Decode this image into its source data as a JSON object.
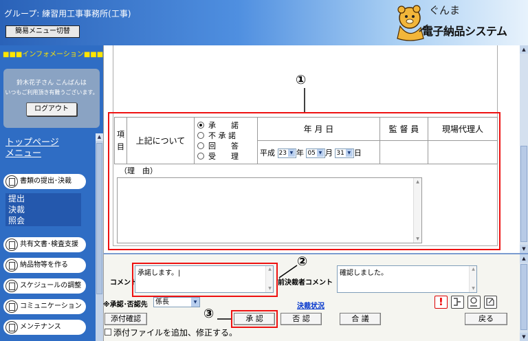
{
  "header": {
    "group_label": "グループ: 練習用工事事務所(工事)",
    "menu_switch_label": "簡易メニュー切替",
    "logo_kana": "ぐんま",
    "logo_main": "電子納品システム"
  },
  "sidebar": {
    "info_heading": "■■■インフォメーション■■■",
    "welcome_name": "鈴木花子さん こんばんは",
    "welcome_msg": "いつもご利用頂き有難うございます。",
    "logout_label": "ログアウト",
    "top_menu_line1": "トップページ",
    "top_menu_line2": "メニュー",
    "nav_items": [
      {
        "label": "書類の提出･決裁"
      },
      {
        "label": "共有文書･検査支援"
      },
      {
        "label": "納品物等を作る"
      },
      {
        "label": "スケジュールの調整"
      },
      {
        "label": "コミュニケーション"
      },
      {
        "label": "メンテナンス"
      }
    ],
    "sub_items": [
      "提出",
      "決裁",
      "照会"
    ]
  },
  "approval_form": {
    "callout_1": "①",
    "item_label": "項目",
    "item_label_top": "項",
    "item_label_bottom": "目",
    "subject": "上記について",
    "options": [
      "承　　諾",
      "不 承 諾",
      "回　　答",
      "受　　理"
    ],
    "selected_option": 0,
    "date_header": "年 月 日",
    "supervisor_header": "監 督 員",
    "site_agent_header": "現場代理人",
    "era": "平成",
    "year": "23",
    "year_unit": "年",
    "month": "05",
    "month_unit": "月",
    "day": "31",
    "day_unit": "日",
    "reason_label": "（理　由）"
  },
  "lower": {
    "callout_2": "②",
    "callout_3": "③",
    "comment_label": "コメント",
    "comment_value": "承諾します。|",
    "prev_comment_label": "前決裁者コメント",
    "prev_comment_value": "確認しました。",
    "approver_label": "※承認･否認先",
    "approver_value": "係長",
    "status_link": "決裁状況",
    "attach_confirm_label": "添付確認",
    "approve_label": "承 認",
    "reject_label": "否 認",
    "consult_label": "合 議",
    "back_label": "戻る",
    "attach_checkbox_label": "添付ファイルを追加、修正する。"
  }
}
